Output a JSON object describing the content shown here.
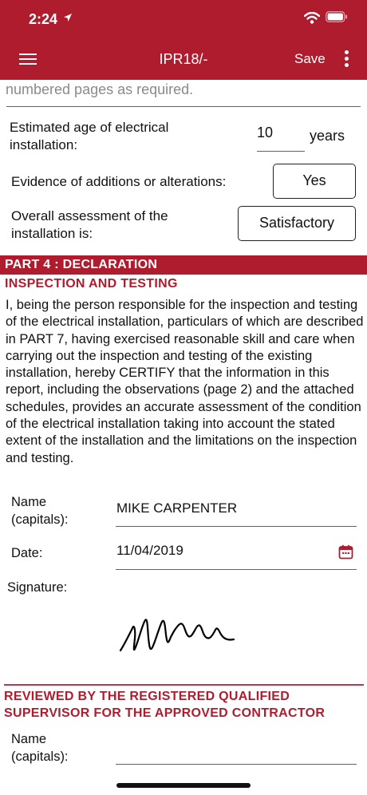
{
  "status_bar": {
    "time": "2:24"
  },
  "nav": {
    "title": "IPR18/-",
    "save_label": "Save"
  },
  "section_top": {
    "trailing_text": "numbered pages as required.",
    "estimated_age_label": "Estimated age of electrical installation:",
    "estimated_age_value": "10",
    "estimated_age_unit": "years",
    "evidence_label": "Evidence of additions or alterations:",
    "evidence_value": "Yes",
    "assessment_label": "Overall assessment of the installation is:",
    "assessment_value": "Satisfactory"
  },
  "part4": {
    "bar_title": "PART 4 : DECLARATION",
    "subtitle": "INSPECTION AND TESTING",
    "declaration": "I, being the person responsible for the inspection and testing of the electrical installation, particulars of which are described in PART 7, having exercised reasonable skill and care when carrying out the inspection and testing of the existing installation, hereby CERTIFY that the information in this report, including the observations (page 2) and the attached schedules, provides an accurate assessment of the condition of the electrical installation taking into account the stated extent of the installation and the limitations on the inspection and testing.",
    "name_label": "Name (capitals):",
    "name_value": "MIKE CARPENTER",
    "date_label": "Date:",
    "date_value": "11/04/2019",
    "signature_label": "Signature:"
  },
  "reviewed": {
    "title": "REVIEWED BY THE REGISTERED QUALIFIED SUPERVISOR FOR THE APPROVED CONTRACTOR",
    "name_label": "Name (capitals):",
    "name_value": ""
  },
  "icons": [
    "location-arrow-icon",
    "wifi-icon",
    "battery-icon",
    "menu-icon",
    "more-vertical-icon",
    "calendar-icon"
  ],
  "colors": {
    "brand_red": "#ae1c2e",
    "divider_red": "#c23648"
  }
}
